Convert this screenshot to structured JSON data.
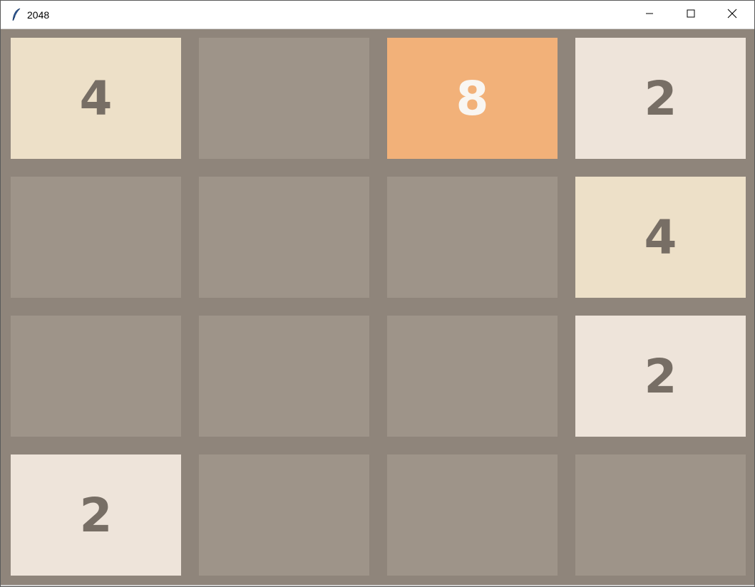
{
  "window": {
    "title": "2048",
    "icon": "feather-icon",
    "controls": [
      "minimize-icon",
      "maximize-icon",
      "close-icon"
    ]
  },
  "board": {
    "rows": 4,
    "cols": 4,
    "cells": [
      [
        "4",
        "",
        "8",
        "2"
      ],
      [
        "",
        "",
        "",
        "4"
      ],
      [
        "",
        "",
        "",
        "2"
      ],
      [
        "2",
        "",
        "",
        ""
      ]
    ]
  },
  "colors": {
    "board_bg": "#8f857b",
    "empty": "#9e9489",
    "tile_2": "#eee4da",
    "tile_4": "#ede0c8",
    "tile_8": "#f2b179",
    "text_dark": "#776e65",
    "text_light": "#f9f6f2"
  }
}
